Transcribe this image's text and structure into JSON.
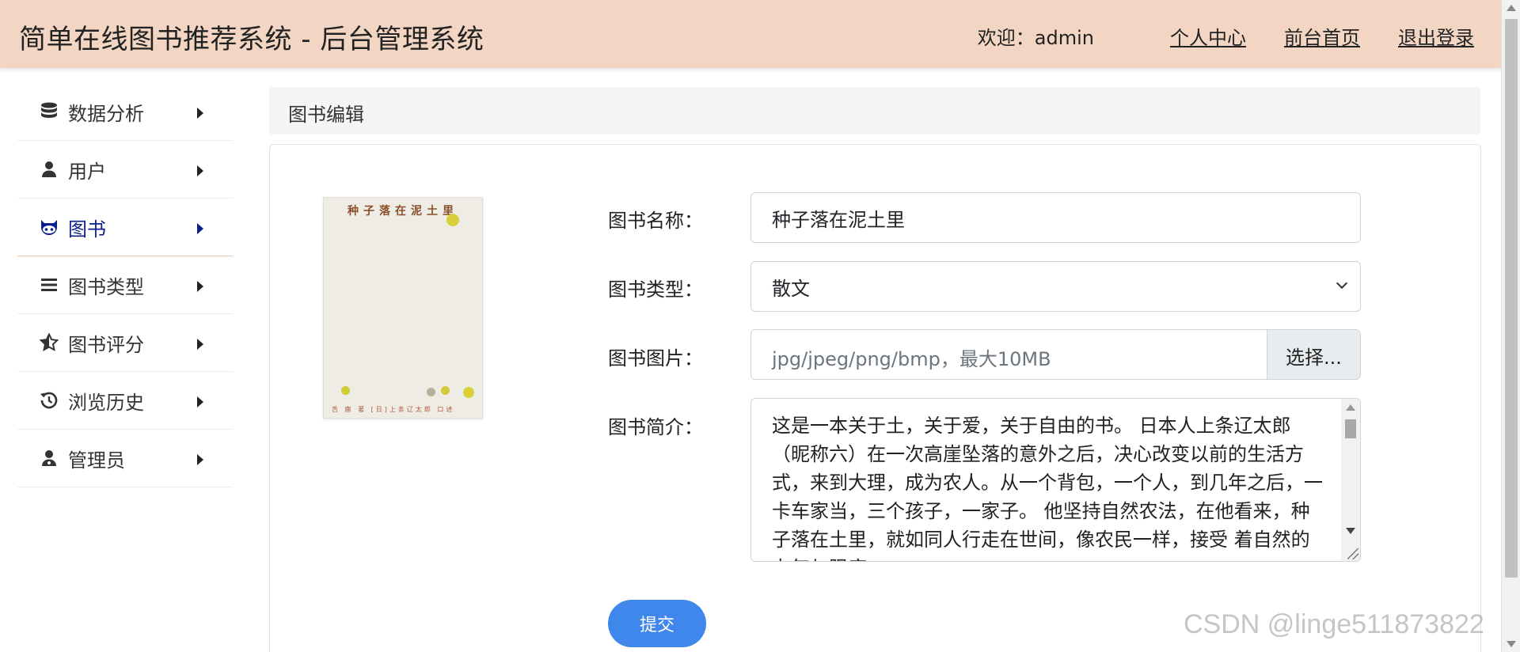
{
  "header": {
    "title": "简单在线图书推荐系统 - 后台管理系统",
    "welcome_label": "欢迎：",
    "username": "admin",
    "links": [
      "个人中心",
      "前台首页",
      "退出登录"
    ],
    "background": "#f2d6c3"
  },
  "sidebar": {
    "items": [
      {
        "label": "数据分析",
        "icon": "database-icon",
        "active": false
      },
      {
        "label": "用户",
        "icon": "user-icon",
        "active": false
      },
      {
        "label": "图书",
        "icon": "github-cat-icon",
        "active": true
      },
      {
        "label": "图书类型",
        "icon": "list-icon",
        "active": false
      },
      {
        "label": "图书评分",
        "icon": "star-half-icon",
        "active": false
      },
      {
        "label": "浏览历史",
        "icon": "history-icon",
        "active": false
      },
      {
        "label": "管理员",
        "icon": "user-doctor-icon",
        "active": false
      }
    ],
    "active_color": "#0b1f8a"
  },
  "breadcrumb": {
    "title": "图书编辑"
  },
  "cover": {
    "title": "种子落在泥土里",
    "footer": "舌 鹿 著   [日]上条辽太郎   口述"
  },
  "form": {
    "name_label": "图书名称：",
    "name_value": "种子落在泥土里",
    "type_label": "图书类型：",
    "type_value": "散文",
    "image_label": "图书图片：",
    "image_placeholder": "jpg/jpeg/png/bmp，最大10MB",
    "image_button": "选择...",
    "intro_label": "图书简介：",
    "intro_value": "这是一本关于土，关于爱，关于自由的书。 日本人上条辽太郎（昵称六）在一次高崖坠落的意外之后，决心改变以前的生活方式，来到大理，成为农人。从一个背包，一个人，到几年之后，一卡车家当，三个孩子，一家子。 他坚持自然农法，在他看来，种子落在土里，就如同人行走在世间，像农民一样，接受 着自然的力气与限度，...",
    "submit_label": "提交",
    "submit_color": "#3f87ea"
  },
  "watermark": "CSDN @linge511873822"
}
